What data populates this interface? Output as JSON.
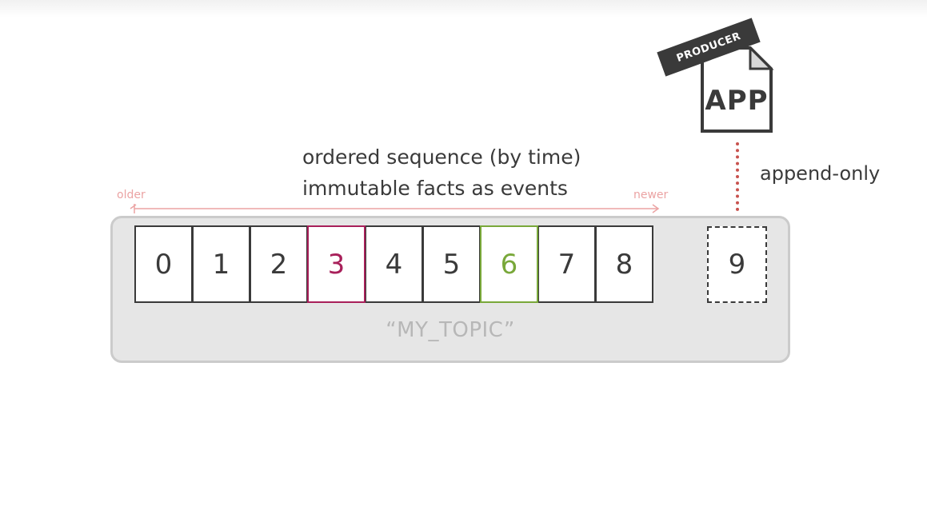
{
  "description": {
    "line1": "ordered sequence (by time)",
    "line2": "immutable facts as events"
  },
  "axis": {
    "start_label": "older",
    "end_label": "newer"
  },
  "log": {
    "offsets": [
      "0",
      "1",
      "2",
      "3",
      "4",
      "5",
      "6",
      "7",
      "8"
    ],
    "highlights": {
      "3": "#a8205a",
      "6": "#79a83a"
    },
    "pending_offset": "9",
    "topic_name": "“MY_TOPIC”"
  },
  "producer": {
    "band_label": "PRODUCER",
    "app_label": "APP",
    "icon": "document-icon",
    "write_mode": "append-only"
  },
  "colors": {
    "axis": "#eba3a3",
    "append_line": "#c8524e",
    "cell_border": "#3a3a3a"
  }
}
